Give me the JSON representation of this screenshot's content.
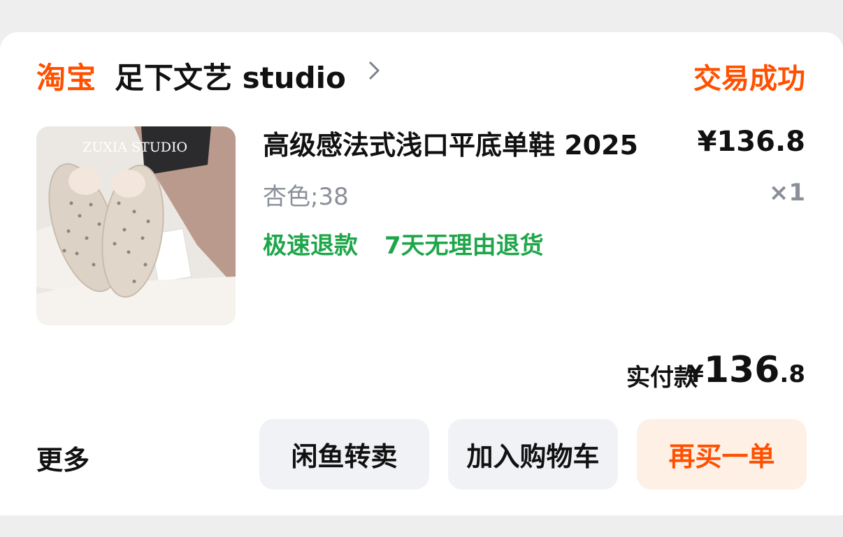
{
  "order": {
    "platform_logo_text": "淘宝",
    "shop_name": "足下文艺 studio",
    "status": "交易成功"
  },
  "item": {
    "image_watermark": "ZUXIA STUDIO",
    "title": "高级感法式浅口平底单鞋 2025",
    "price": "¥136.8",
    "sku": "杏色;38",
    "quantity": "×1",
    "tags": [
      "极速退款",
      "7天无理由退货"
    ]
  },
  "payment": {
    "label": "实付款",
    "currency_symbol": "¥",
    "amount_integer": "136",
    "amount_decimal": ".8"
  },
  "actions": {
    "more_label": "更多",
    "buttons": [
      "闲鱼转卖",
      "加入购物车",
      "再买一单"
    ]
  },
  "colors": {
    "brand_orange": "#ff5000",
    "tag_green": "#1fa64a",
    "muted_grey": "#8a8f99",
    "page_background": "#eeeeee"
  }
}
